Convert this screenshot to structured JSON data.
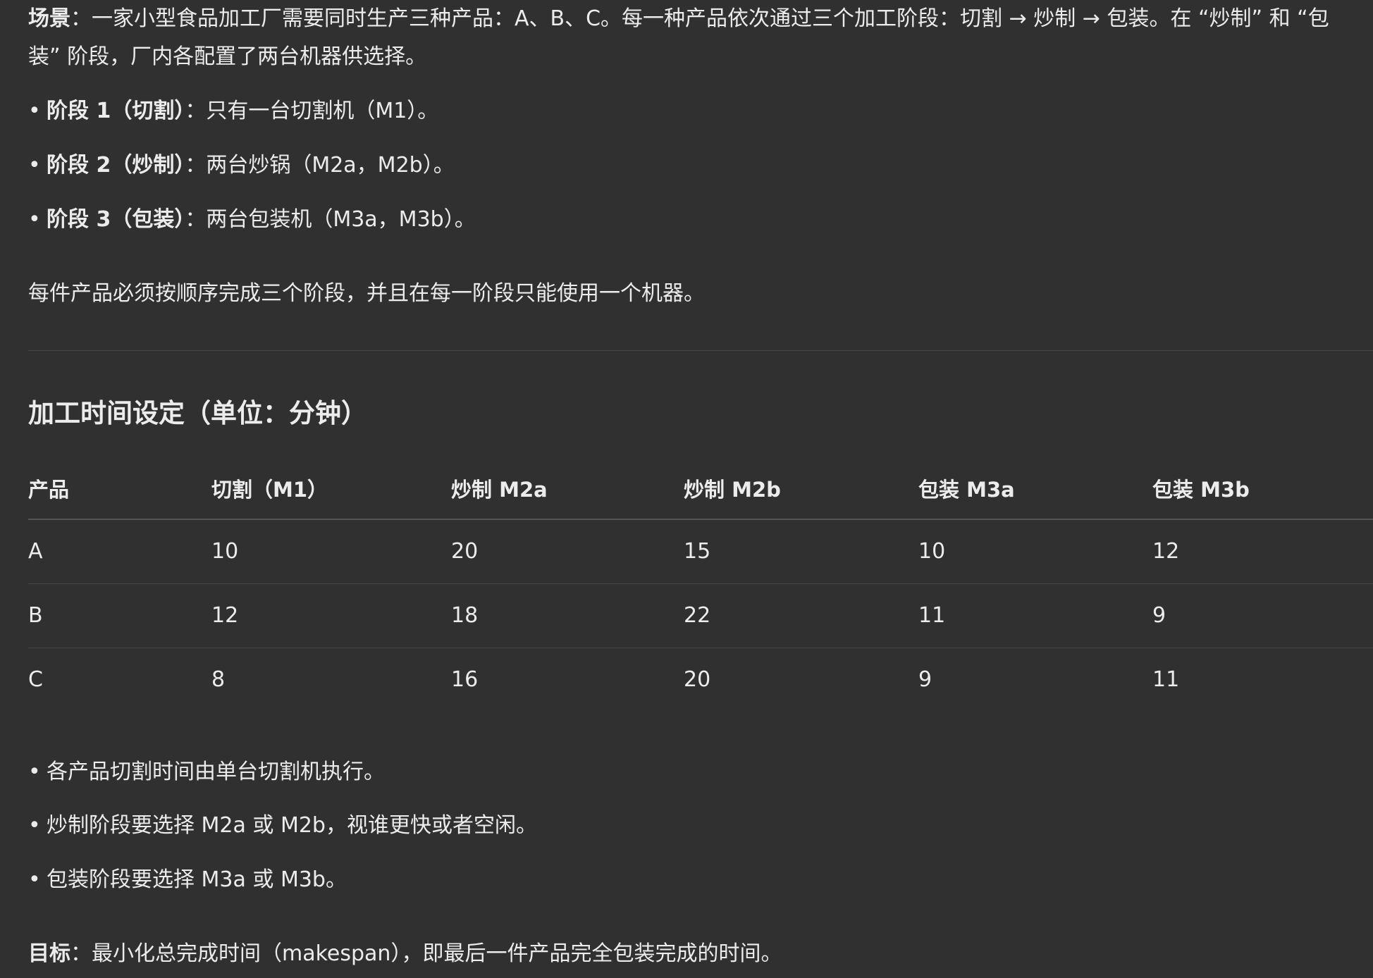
{
  "intro": {
    "label": "场景",
    "colon": "：",
    "text": "一家小型食品加工厂需要同时生产三种产品：A、B、C。每一种产品依次通过三个加工阶段：切割 → 炒制 → 包装。在 “炒制” 和 “包装” 阶段，厂内各配置了两台机器供选择。"
  },
  "stages": [
    {
      "label": "阶段 1（切割）",
      "text": "：只有一台切割机（M1）。"
    },
    {
      "label": "阶段 2（炒制）",
      "text": "：两台炒锅（M2a，M2b）。"
    },
    {
      "label": "阶段 3（包装）",
      "text": "：两台包装机（M3a，M3b）。"
    }
  ],
  "sequence_note": "每件产品必须按顺序完成三个阶段，并且在每一阶段只能使用一个机器。",
  "table_heading": "加工时间设定（单位：分钟）",
  "table": {
    "headers": [
      "产品",
      "切割（M1）",
      "炒制 M2a",
      "炒制 M2b",
      "包装 M3a",
      "包装 M3b"
    ],
    "rows": [
      [
        "A",
        "10",
        "20",
        "15",
        "10",
        "12"
      ],
      [
        "B",
        "12",
        "18",
        "22",
        "11",
        "9"
      ],
      [
        "C",
        "8",
        "16",
        "20",
        "9",
        "11"
      ]
    ]
  },
  "notes": [
    "各产品切割时间由单台切割机执行。",
    "炒制阶段要选择 M2a 或 M2b，视谁更快或者空闲。",
    "包装阶段要选择 M3a 或 M3b。"
  ],
  "goal": {
    "label": "目标",
    "colon": "：",
    "text": "最小化总完成时间（makespan），即最后一件产品完全包装完成的时间。"
  },
  "bullet_glyph": "•"
}
